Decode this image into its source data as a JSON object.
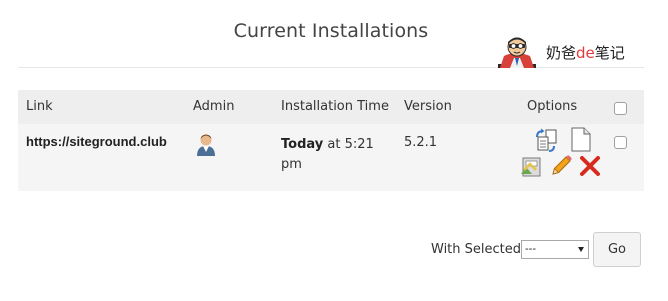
{
  "page_title": "Current Installations",
  "watermark": {
    "text_before": "奶爸",
    "text_accent": "de",
    "text_after": "笔记"
  },
  "table": {
    "headers": {
      "link": "Link",
      "admin": "Admin",
      "installation_time": "Installation Time",
      "version": "Version",
      "options": "Options"
    },
    "rows": [
      {
        "link": "https://siteground.club",
        "time_bold": "Today",
        "time_rest": " at 5:21 pm",
        "version": "5.2.1",
        "options_icons": [
          "clone-icon",
          "file-icon",
          "backup-icon",
          "edit-pencil-icon",
          "delete-x-icon"
        ]
      }
    ]
  },
  "footer": {
    "with_selected_label": "With Selected:",
    "select_value": "---",
    "go_label": "Go"
  }
}
